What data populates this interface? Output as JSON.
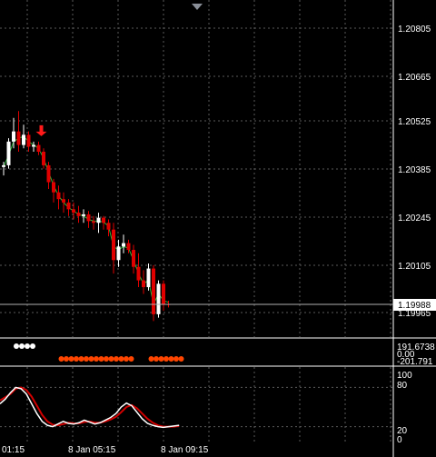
{
  "price_axis": {
    "labels": [
      "1.20805",
      "1.20665",
      "1.20525",
      "1.20385",
      "1.20245",
      "1.20105",
      "1.19965"
    ],
    "current_price": "1.19988"
  },
  "indicator_axis": {
    "labels": [
      "191.6738",
      "0.00",
      "-201.791"
    ]
  },
  "stoch_axis": {
    "labels": [
      "100",
      "80",
      "20",
      "0"
    ]
  },
  "time_axis": {
    "labels": [
      "01:15",
      "8 Jan 05:15",
      "8 Jan 09:15"
    ]
  },
  "colors": {
    "background": "#000000",
    "grid": "#5a5a5a",
    "bear_candle": "#e00000",
    "bull_candle": "#ffffff",
    "ma_line": "#2db83a",
    "sell_arrow": "#ff1a1a",
    "dot_white": "#ffffff",
    "dot_orange": "#ff4500",
    "stoch_main": "#ffffff",
    "stoch_signal": "#d00000"
  },
  "icons": {
    "sell_arrow": "arrow-down-icon",
    "scroll_marker": "triangle-down-icon"
  },
  "chart_data": {
    "type": "candlestick",
    "symbol_scale": {
      "ylim": [
        1.1993,
        1.2087
      ]
    },
    "candles": [
      {
        "o": 1.20395,
        "h": 1.2041,
        "l": 1.2037,
        "c": 1.204
      },
      {
        "o": 1.204,
        "h": 1.2048,
        "l": 1.2039,
        "c": 1.2047
      },
      {
        "o": 1.2047,
        "h": 1.2054,
        "l": 1.2045,
        "c": 1.205
      },
      {
        "o": 1.205,
        "h": 1.2056,
        "l": 1.2044,
        "c": 1.2046
      },
      {
        "o": 1.2046,
        "h": 1.2052,
        "l": 1.2045,
        "c": 1.2049
      },
      {
        "o": 1.2049,
        "h": 1.205,
        "l": 1.2044,
        "c": 1.20455
      },
      {
        "o": 1.20455,
        "h": 1.2047,
        "l": 1.2044,
        "c": 1.2046
      },
      {
        "o": 1.2046,
        "h": 1.2047,
        "l": 1.2043,
        "c": 1.2044
      },
      {
        "o": 1.2044,
        "h": 1.2045,
        "l": 1.2039,
        "c": 1.204
      },
      {
        "o": 1.204,
        "h": 1.2041,
        "l": 1.2033,
        "c": 1.2035
      },
      {
        "o": 1.2035,
        "h": 1.2036,
        "l": 1.2029,
        "c": 1.2032
      },
      {
        "o": 1.2032,
        "h": 1.2034,
        "l": 1.2027,
        "c": 1.203
      },
      {
        "o": 1.203,
        "h": 1.2032,
        "l": 1.2026,
        "c": 1.2029
      },
      {
        "o": 1.2029,
        "h": 1.203,
        "l": 1.2025,
        "c": 1.2027
      },
      {
        "o": 1.2027,
        "h": 1.2029,
        "l": 1.2024,
        "c": 1.2026
      },
      {
        "o": 1.2026,
        "h": 1.2028,
        "l": 1.2023,
        "c": 1.2025
      },
      {
        "o": 1.2025,
        "h": 1.2027,
        "l": 1.2023,
        "c": 1.20255
      },
      {
        "o": 1.20255,
        "h": 1.20265,
        "l": 1.20215,
        "c": 1.20235
      },
      {
        "o": 1.20235,
        "h": 1.2025,
        "l": 1.2021,
        "c": 1.2023
      },
      {
        "o": 1.2023,
        "h": 1.2026,
        "l": 1.202,
        "c": 1.20245
      },
      {
        "o": 1.20245,
        "h": 1.2025,
        "l": 1.2021,
        "c": 1.2023
      },
      {
        "o": 1.2023,
        "h": 1.2024,
        "l": 1.2019,
        "c": 1.2021
      },
      {
        "o": 1.2021,
        "h": 1.2023,
        "l": 1.2008,
        "c": 1.2012
      },
      {
        "o": 1.2012,
        "h": 1.2018,
        "l": 1.201,
        "c": 1.2016
      },
      {
        "o": 1.2016,
        "h": 1.20195,
        "l": 1.2014,
        "c": 1.2017
      },
      {
        "o": 1.2017,
        "h": 1.2018,
        "l": 1.2014,
        "c": 1.2015
      },
      {
        "o": 1.2015,
        "h": 1.20165,
        "l": 1.2008,
        "c": 1.201
      },
      {
        "o": 1.201,
        "h": 1.2014,
        "l": 1.2004,
        "c": 1.2006
      },
      {
        "o": 1.2006,
        "h": 1.2009,
        "l": 1.2002,
        "c": 1.2004
      },
      {
        "o": 1.2004,
        "h": 1.2011,
        "l": 1.2003,
        "c": 1.20095
      },
      {
        "o": 1.20095,
        "h": 1.20105,
        "l": 1.1994,
        "c": 1.1996
      },
      {
        "o": 1.1996,
        "h": 1.2006,
        "l": 1.1995,
        "c": 1.2005
      },
      {
        "o": 1.2005,
        "h": 1.2006,
        "l": 1.1997,
        "c": 1.1999
      },
      {
        "o": 1.1999,
        "h": 1.2,
        "l": 1.1998,
        "c": 1.19988
      }
    ],
    "ma_line": [
      1.20395,
      1.2043,
      1.2047,
      1.2048,
      1.20485,
      1.2047,
      1.2046,
      1.2045,
      1.2042,
      1.2038,
      1.2034,
      1.2031,
      1.2029,
      1.20275,
      1.20265,
      1.20255,
      1.2025,
      1.2024,
      1.20235,
      1.20235,
      1.20232,
      1.2022,
      1.2016,
      1.2015,
      1.2016,
      1.20155,
      1.2012,
      1.2008,
      1.2005,
      1.2006,
      1.1999,
      1.2002,
      1.2,
      1.19995
    ],
    "sell_arrow_index": 7,
    "dots": {
      "white_indices": [
        0,
        1,
        2,
        3
      ],
      "orange_indices": [
        9,
        10,
        11,
        12,
        13,
        14,
        15,
        16,
        17,
        18,
        19,
        20,
        21,
        22,
        23,
        27,
        28,
        29,
        30,
        31,
        32,
        33
      ]
    },
    "stochastic": {
      "ylim": [
        0,
        100
      ],
      "levels": [
        80,
        20
      ],
      "main": [
        55,
        62,
        72,
        80,
        78,
        70,
        55,
        40,
        28,
        22,
        20,
        24,
        28,
        25,
        24,
        26,
        30,
        27,
        24,
        26,
        30,
        34,
        40,
        50,
        56,
        52,
        42,
        32,
        25,
        22,
        20,
        19,
        20,
        21,
        22
      ],
      "signal": [
        60,
        65,
        70,
        78,
        80,
        76,
        66,
        52,
        38,
        28,
        23,
        22,
        24,
        26,
        25,
        25,
        27,
        28,
        26,
        26,
        28,
        31,
        35,
        42,
        50,
        53,
        48,
        40,
        32,
        26,
        22,
        20,
        20,
        20,
        21
      ]
    }
  }
}
